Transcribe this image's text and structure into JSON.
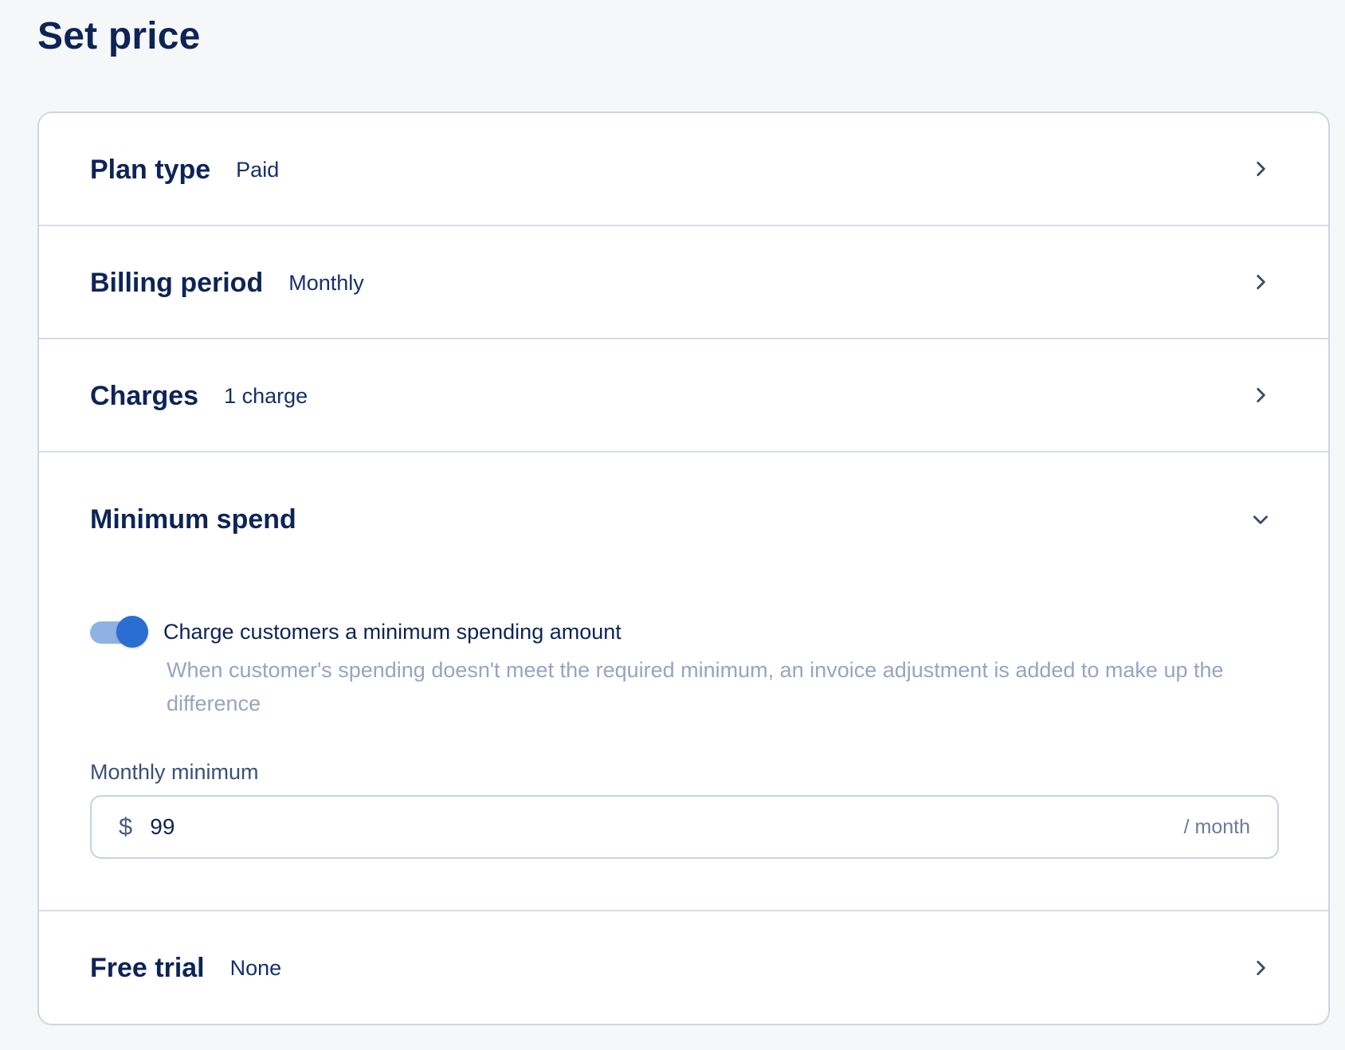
{
  "page": {
    "title": "Set price"
  },
  "sections": {
    "plan_type": {
      "title": "Plan type",
      "value": "Paid",
      "icon": "chevron-right-icon"
    },
    "billing_period": {
      "title": "Billing period",
      "value": "Monthly",
      "icon": "chevron-right-icon"
    },
    "charges": {
      "title": "Charges",
      "value": "1 charge",
      "icon": "chevron-right-icon"
    },
    "minimum_spend": {
      "title": "Minimum spend",
      "icon": "chevron-down-icon",
      "expanded": true,
      "toggle": {
        "enabled": true,
        "label": "Charge customers a minimum spending amount",
        "help": "When customer's spending doesn't meet the required minimum, an invoice adjustment is added to make up the difference"
      },
      "field": {
        "label": "Monthly minimum",
        "prefix": "$",
        "value": "99",
        "suffix": "/ month"
      }
    },
    "free_trial": {
      "title": "Free trial",
      "value": "None",
      "icon": "chevron-right-icon"
    }
  },
  "colors": {
    "page_background": "#f6f7f9",
    "heading": "#0d2456",
    "border": "#cfd6e1",
    "toggle_knob": "#2b6ed2",
    "toggle_track": "#8fb2e4",
    "help_text": "#97a5c0"
  }
}
